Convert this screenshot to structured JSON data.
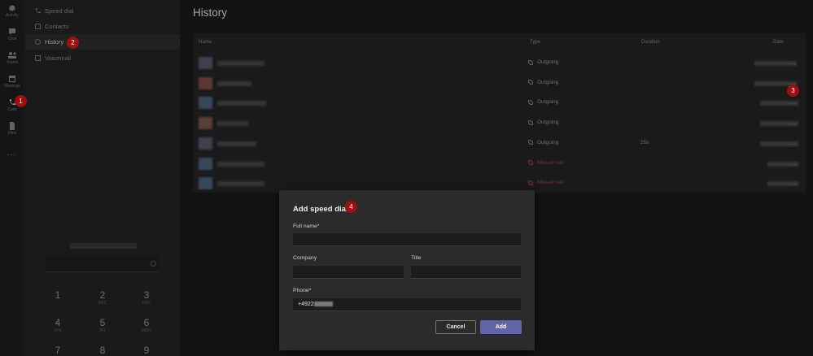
{
  "rail": {
    "items": [
      {
        "label": "Activity",
        "icon": "bell-icon"
      },
      {
        "label": "Chat",
        "icon": "chat-icon"
      },
      {
        "label": "Teams",
        "icon": "teams-icon"
      },
      {
        "label": "Meetings",
        "icon": "calendar-icon"
      },
      {
        "label": "Calls",
        "icon": "phone-icon"
      },
      {
        "label": "Files",
        "icon": "file-icon"
      }
    ],
    "more": "..."
  },
  "nav": {
    "items": [
      {
        "label": "Speed dial",
        "icon": "phone-icon"
      },
      {
        "label": "Contacts",
        "icon": "contacts-icon"
      },
      {
        "label": "History",
        "icon": "clock-icon"
      },
      {
        "label": "Voicemail",
        "icon": "voicemail-icon"
      }
    ]
  },
  "dialpad": {
    "keys": [
      {
        "n": "1",
        "l": ""
      },
      {
        "n": "2",
        "l": "ABC"
      },
      {
        "n": "3",
        "l": "DEF"
      },
      {
        "n": "4",
        "l": "GHI"
      },
      {
        "n": "5",
        "l": "JKL"
      },
      {
        "n": "6",
        "l": "MNO"
      },
      {
        "n": "7",
        "l": ""
      },
      {
        "n": "8",
        "l": ""
      },
      {
        "n": "9",
        "l": ""
      }
    ]
  },
  "history": {
    "title": "History",
    "columns": {
      "name": "Name",
      "type": "Type",
      "duration": "Duration",
      "date": "Date"
    },
    "rows": [
      {
        "type": "Outgoing",
        "duration": "",
        "status": "outgoing",
        "avatar": "#6a6a8a"
      },
      {
        "type": "Outgoing",
        "duration": "",
        "status": "outgoing",
        "avatar": "#a05a5a"
      },
      {
        "type": "Outgoing",
        "duration": "",
        "status": "outgoing",
        "avatar": "#5a7a9a"
      },
      {
        "type": "Outgoing",
        "duration": "",
        "status": "outgoing",
        "avatar": "#9a6a5a"
      },
      {
        "type": "Outgoing",
        "duration": "25s",
        "status": "outgoing",
        "avatar": "#6a6a8a"
      },
      {
        "type": "Missed call",
        "duration": "",
        "status": "missed",
        "avatar": "#5a7a9a"
      },
      {
        "type": "Missed call",
        "duration": "",
        "status": "missed",
        "avatar": "#5a7a9a"
      }
    ],
    "more": "..."
  },
  "dialog": {
    "title": "Add speed dial",
    "full_name_label": "Full name*",
    "company_label": "Company",
    "title_label": "Title",
    "phone_label": "Phone*",
    "phone_value": "+4922",
    "cancel_label": "Cancel",
    "add_label": "Add"
  },
  "callouts": [
    "1",
    "2",
    "3",
    "4"
  ],
  "colors": {
    "accent": "#6264a7",
    "callout": "#9d1010",
    "missed": "#a84848"
  }
}
